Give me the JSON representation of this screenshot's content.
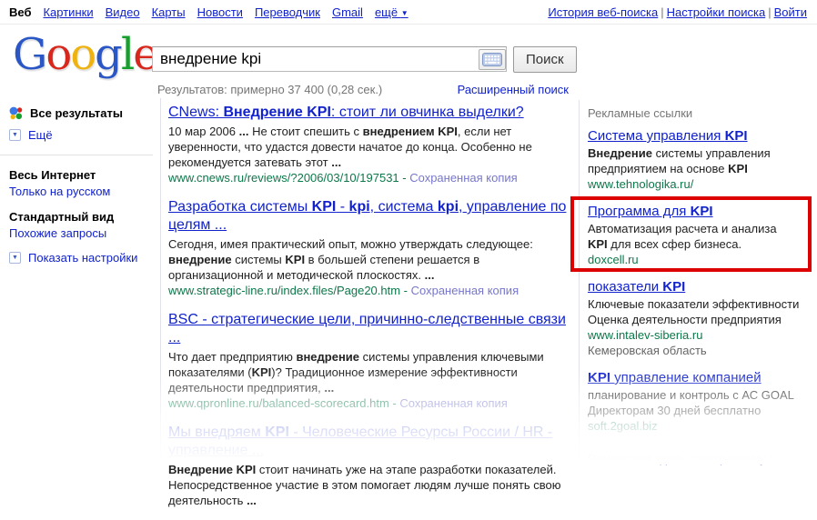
{
  "colors": {
    "link_blue": "#1122cc",
    "url_green": "#0e774a",
    "cached_blue": "#7777cc",
    "highlight_red": "#dd0000"
  },
  "top_nav": {
    "active": "Веб",
    "links": [
      "Картинки",
      "Видео",
      "Карты",
      "Новости",
      "Переводчик",
      "Gmail"
    ],
    "more": "ещё",
    "more_caret": "▼",
    "right_links": [
      "История веб-поиска",
      "Настройки поиска",
      "Войти"
    ]
  },
  "logo": {
    "letters": [
      {
        "ch": "G",
        "color": "#2a56c6"
      },
      {
        "ch": "o",
        "color": "#d8271c"
      },
      {
        "ch": "o",
        "color": "#eeb211"
      },
      {
        "ch": "g",
        "color": "#2a56c6"
      },
      {
        "ch": "l",
        "color": "#169f2d"
      },
      {
        "ch": "e",
        "color": "#d8271c"
      }
    ]
  },
  "search": {
    "query": "внедрение kpi",
    "button_label": "Поиск",
    "stats": "Результатов: примерно 37 400 (0,28 сек.)",
    "advanced_link": "Расширенный поиск"
  },
  "sidebar": {
    "all_results": "Все результаты",
    "more": "Ещё",
    "web_heading": "Весь Интернет",
    "russian_only": "Только на русском",
    "view_heading": "Стандартный вид",
    "related": "Похожие запросы",
    "show_settings": "Показать настройки"
  },
  "results": [
    {
      "title": [
        [
          "CNews: ",
          0
        ],
        [
          "Внедрение KPI",
          1
        ],
        [
          ": стоит ли овчинка выделки?",
          0
        ]
      ],
      "snippet": [
        [
          "10 мар 2006 ",
          0
        ],
        [
          "... ",
          1
        ],
        [
          "Не стоит спешить с ",
          0
        ],
        [
          "внедрением KPI",
          1
        ],
        [
          ", если нет уверенности, что удастся довести начатое до конца. Особенно не рекомендуется затевать этот ",
          0
        ],
        [
          "...",
          1
        ]
      ],
      "url": "www.cnews.ru/reviews/?2006/03/10/197531",
      "cached": "Сохраненная копия"
    },
    {
      "title": [
        [
          "Разработка системы ",
          0
        ],
        [
          "KPI",
          1
        ],
        [
          " - ",
          0
        ],
        [
          "kpi",
          1
        ],
        [
          ", система ",
          0
        ],
        [
          "kpi",
          1
        ],
        [
          ", управление по целям ...",
          0
        ]
      ],
      "snippet": [
        [
          "Сегодня, имея практический опыт, можно утверждать следующее: ",
          0
        ],
        [
          "внедрение",
          1
        ],
        [
          " системы ",
          0
        ],
        [
          "KPI",
          1
        ],
        [
          " в большей степени решается в организационной и методической плоскостях. ",
          0
        ],
        [
          "...",
          1
        ]
      ],
      "url": "www.strategic-line.ru/index.files/Page20.htm",
      "cached": "Сохраненная копия"
    },
    {
      "title": [
        [
          "BSC - стратегические цели, причинно-следственные связи ...",
          0
        ]
      ],
      "snippet": [
        [
          "Что дает предприятию ",
          0
        ],
        [
          "внедрение",
          1
        ],
        [
          " системы управления ключевыми показателями (",
          0
        ],
        [
          "KPI",
          1
        ],
        [
          ")? Традиционное измерение эффективности деятельности предприятия, ",
          0
        ],
        [
          "...",
          1
        ]
      ],
      "url": "www.qpronline.ru/balanced-scorecard.htm",
      "cached": "Сохраненная копия"
    },
    {
      "title": [
        [
          "Мы внедряем ",
          0
        ],
        [
          "KPI",
          1
        ],
        [
          " - Человеческие Ресурсы России / HR - управление ...",
          0
        ]
      ],
      "snippet": [
        [
          "Внедрение KPI",
          1
        ],
        [
          " стоит начинать уже на этапе разработки показателей. Непосредственное участие в этом помогает людям лучше понять свою деятельность ",
          0
        ],
        [
          "...",
          1
        ]
      ],
      "url": "",
      "cached": ""
    }
  ],
  "ads": {
    "heading": "Рекламные ссылки",
    "items": [
      {
        "title": [
          [
            "Система управления ",
            0
          ],
          [
            "KPI",
            1
          ]
        ],
        "desc_lines": [
          [
            [
              "Внедрение",
              1
            ],
            [
              " системы управления",
              0
            ]
          ],
          [
            [
              "предприятием на основе ",
              0
            ],
            [
              "KPI",
              1
            ]
          ]
        ],
        "url": "www.tehnologika.ru/",
        "region": "",
        "highlighted": false
      },
      {
        "title": [
          [
            "Программа для ",
            0
          ],
          [
            "KPI",
            1
          ]
        ],
        "desc_lines": [
          [
            [
              "Автоматизация расчета и анализа",
              0
            ]
          ],
          [
            [
              "KPI",
              1
            ],
            [
              " для всех сфер бизнеса.",
              0
            ]
          ]
        ],
        "url": "doxcell.ru",
        "region": "",
        "highlighted": true
      },
      {
        "title": [
          [
            "показатели ",
            0
          ],
          [
            "KPI",
            1
          ]
        ],
        "desc_lines": [
          [
            [
              "Ключевые показатели эффективности",
              0
            ]
          ],
          [
            [
              "Оценка деятельности предприятия",
              0
            ]
          ]
        ],
        "url": "www.intalev-siberia.ru",
        "region": "Кемеровская область",
        "highlighted": false
      },
      {
        "title": [
          [
            "KPI",
            1
          ],
          [
            " управление компанией",
            0
          ]
        ],
        "desc_lines": [
          [
            [
              "планирование и контроль с АС GOAL",
              0
            ]
          ],
          [
            [
              "Директорам 30 дней бесплатно",
              0
            ]
          ]
        ],
        "url": "soft.2goal.biz",
        "region": "",
        "highlighted": false
      }
    ],
    "place_ad": "Разместите здесь свою рекламу »"
  }
}
